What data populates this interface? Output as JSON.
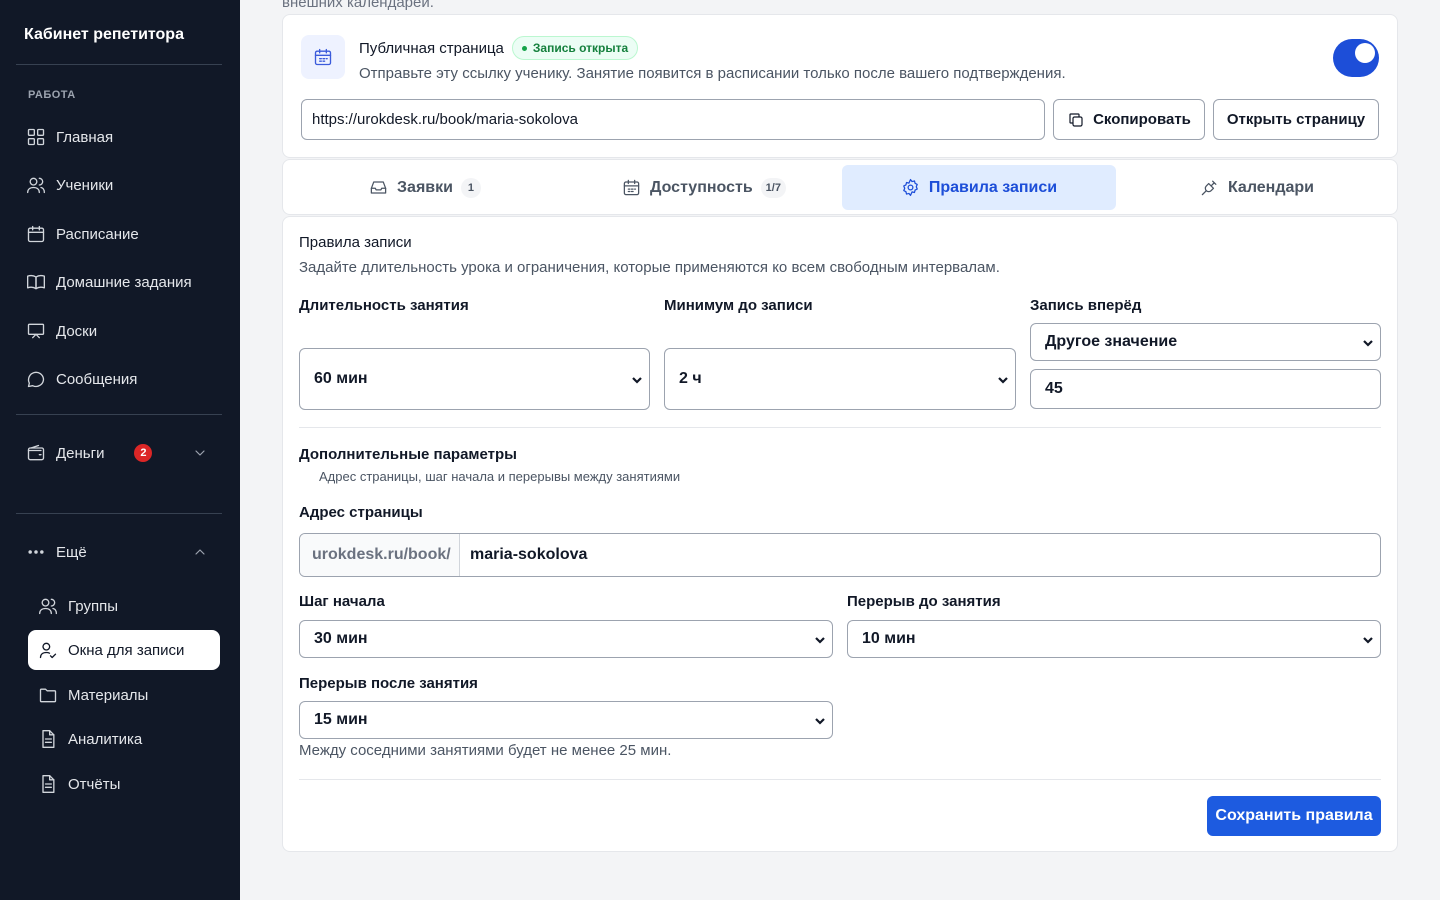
{
  "sidebar": {
    "brand": "Кабинет репетитора",
    "section_work": "РАБОТА",
    "items": [
      {
        "label": "Главная",
        "icon": "dashboard-icon"
      },
      {
        "label": "Ученики",
        "icon": "users-icon"
      },
      {
        "label": "Расписание",
        "icon": "calendar-icon"
      },
      {
        "label": "Домашние задания",
        "icon": "book-icon"
      },
      {
        "label": "Доски",
        "icon": "whiteboard-icon"
      },
      {
        "label": "Сообщения",
        "icon": "chat-icon"
      }
    ],
    "money": {
      "label": "Деньги",
      "badge": "2",
      "icon": "wallet-icon"
    },
    "more": {
      "label": "Ещё",
      "icon": "more-dots-icon"
    },
    "sub_items": [
      {
        "label": "Группы",
        "icon": "group-icon",
        "active": false
      },
      {
        "label": "Окна для записи",
        "icon": "user-check-icon",
        "active": true
      },
      {
        "label": "Материалы",
        "icon": "folder-icon",
        "active": false
      },
      {
        "label": "Аналитика",
        "icon": "document-icon",
        "active": false
      },
      {
        "label": "Отчёты",
        "icon": "document-icon",
        "active": false
      }
    ]
  },
  "top_cut_text": "внешних календарей.",
  "public_page": {
    "title": "Публичная страница",
    "status": "Запись открыта",
    "description": "Отправьте эту ссылку ученику. Занятие появится в расписании только после вашего подтверждения.",
    "url": "https://urokdesk.ru/book/maria-sokolova",
    "copy_label": "Скопировать",
    "open_label": "Открыть страницу",
    "toggle_on": true
  },
  "tabs": [
    {
      "label": "Заявки",
      "count": "1",
      "icon": "inbox-icon",
      "active": false
    },
    {
      "label": "Доступность",
      "count": "1/7",
      "icon": "calendar-icon",
      "active": false
    },
    {
      "label": "Правила записи",
      "count": "",
      "icon": "gear-icon",
      "active": true
    },
    {
      "label": "Календари",
      "count": "",
      "icon": "plug-icon",
      "active": false
    }
  ],
  "rules": {
    "title": "Правила записи",
    "subtitle": "Задайте длительность урока и ограничения, которые применяются ко всем свободным интервалам.",
    "duration_label": "Длительность занятия",
    "duration_value": "60 мин",
    "min_label": "Минимум до записи",
    "min_value": "2 ч",
    "ahead_label": "Запись вперёд",
    "ahead_value": "Другое значение",
    "ahead_custom": "45",
    "extra_title": "Дополнительные параметры",
    "extra_note": "Адрес страницы, шаг начала и перерывы между занятиями",
    "address_label": "Адрес страницы",
    "address_prefix": "urokdesk.ru/book/",
    "address_value": "maria-sokolova",
    "step_label": "Шаг начала",
    "step_value": "30 мин",
    "before_label": "Перерыв до занятия",
    "before_value": "10 мин",
    "after_label": "Перерыв после занятия",
    "after_value": "15 мин",
    "hint": "Между соседними занятиями будет не менее 25 мин.",
    "save_label": "Сохранить правила"
  }
}
